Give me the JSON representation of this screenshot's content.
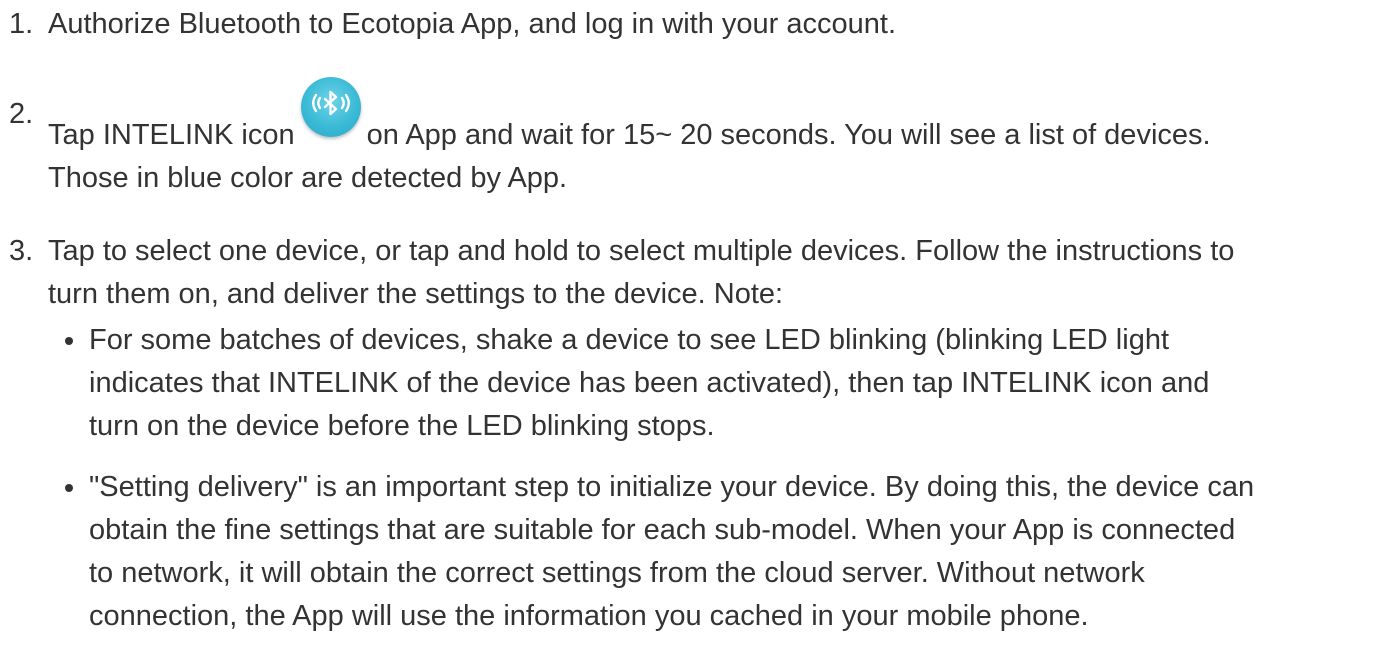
{
  "steps": [
    {
      "number": "1.",
      "text": "Authorize Bluetooth to Ecotopia App, and log in with your account."
    },
    {
      "number": "2.",
      "text_before_icon": "Tap INTELINK icon",
      "icon": "bluetooth-signal-icon",
      "text_after_icon": "on App and wait for 15~ 20 seconds. You will see a list of devices.",
      "text_line2": "Those in blue color are detected by App."
    },
    {
      "number": "3.",
      "text_line1": "Tap to select one device, or tap and hold to select multiple devices. Follow the instructions to",
      "text_line2": "turn them on, and deliver the settings to the device. Note:",
      "notes": [
        {
          "lines": [
            "For some batches of devices, shake a device to see LED blinking (blinking LED light",
            "indicates that INTELINK of the device has been activated), then tap INTELINK icon and",
            "turn on the device before the LED blinking stops."
          ]
        },
        {
          "lines": [
            "\"Setting delivery\" is an important step to initialize your device. By doing this, the device can",
            "obtain the fine settings that are suitable for each sub-model. When your App is connected",
            "to network, it will obtain the correct settings from the cloud server. Without network",
            "connection, the App will use the information you cached in your mobile phone."
          ]
        }
      ]
    }
  ],
  "colors": {
    "text": "#333333",
    "icon": "#3bbad6",
    "background": "#ffffff"
  }
}
